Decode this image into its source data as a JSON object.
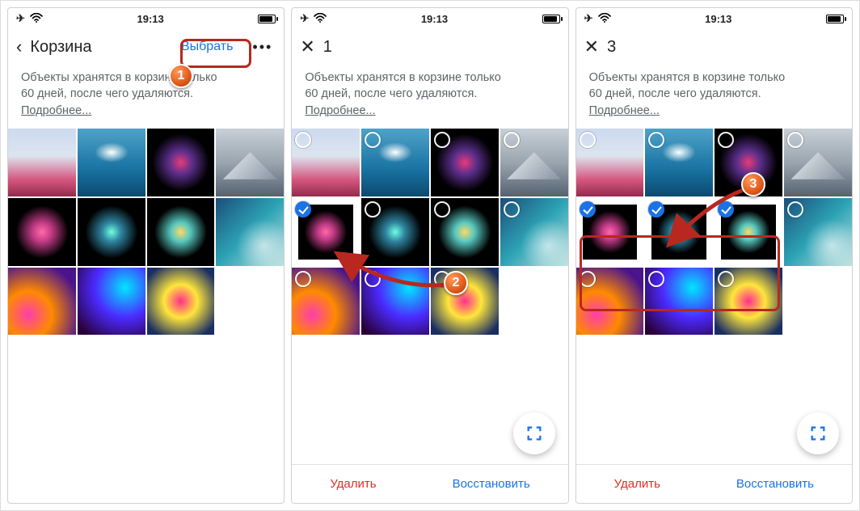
{
  "status": {
    "time": "19:13"
  },
  "screen1": {
    "title": "Корзина",
    "select_label": "Выбрать",
    "info1": "Объекты хранятся в корзине только",
    "info2": "60 дней, после чего удаляются.",
    "more": "Подробнее..."
  },
  "screen2": {
    "count": "1",
    "info1": "Объекты хранятся в корзине только",
    "info2": "60 дней, после чего удаляются.",
    "more": "Подробнее...",
    "delete": "Удалить",
    "restore": "Восстановить"
  },
  "screen3": {
    "count": "3",
    "info1": "Объекты хранятся в корзине только",
    "info2": "60 дней, после чего удаляются.",
    "more": "Подробнее...",
    "delete": "Удалить",
    "restore": "Восстановить"
  },
  "badges": {
    "b1": "1",
    "b2": "2",
    "b3": "3"
  }
}
